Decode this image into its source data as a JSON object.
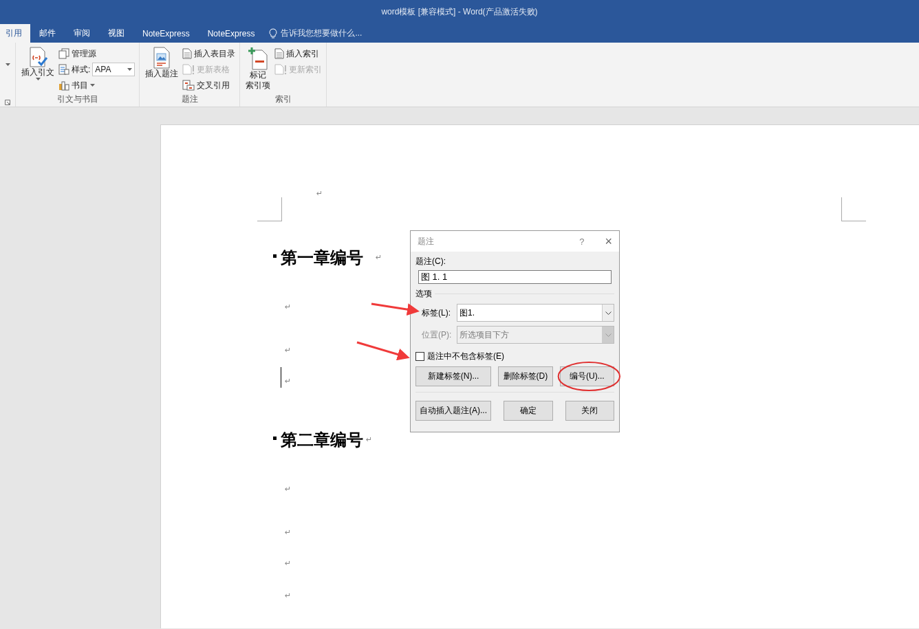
{
  "window": {
    "title": "word模板 [兼容模式] - Word(产品激活失败)"
  },
  "tabs": [
    {
      "label": "引用",
      "selected": true
    },
    {
      "label": "邮件",
      "selected": false
    },
    {
      "label": "审阅",
      "selected": false
    },
    {
      "label": "视图",
      "selected": false
    },
    {
      "label": "NoteExpress",
      "selected": false
    },
    {
      "label": "NoteExpress",
      "selected": false
    }
  ],
  "tell_me": {
    "placeholder": "告诉我您想要做什么..."
  },
  "ribbon": {
    "groups": [
      {
        "label": "引文与书目",
        "large": {
          "lines": [
            "插入引文"
          ],
          "dropdown": true
        },
        "small": [
          {
            "kind": "button",
            "label": "管理源",
            "disabled": false,
            "dropdown": false
          },
          {
            "kind": "combo",
            "label": "样式:",
            "value": "APA"
          },
          {
            "kind": "button",
            "label": "书目",
            "disabled": false,
            "dropdown": true
          }
        ]
      },
      {
        "label": "题注",
        "large": {
          "lines": [
            "插入题注"
          ],
          "dropdown": false
        },
        "small": [
          {
            "kind": "button",
            "label": "插入表目录",
            "disabled": false,
            "dropdown": false
          },
          {
            "kind": "button",
            "label": "更新表格",
            "disabled": true,
            "dropdown": false
          },
          {
            "kind": "button",
            "label": "交叉引用",
            "disabled": false,
            "dropdown": false
          }
        ]
      },
      {
        "label": "索引",
        "large": {
          "lines": [
            "标记",
            "索引项"
          ],
          "dropdown": false
        },
        "small": [
          {
            "kind": "button",
            "label": "插入索引",
            "disabled": false,
            "dropdown": false
          },
          {
            "kind": "button",
            "label": "更新索引",
            "disabled": true,
            "dropdown": false
          }
        ]
      }
    ]
  },
  "document": {
    "paragraphs": [
      {
        "kind": "empty",
        "mark": "↵",
        "caret": false
      },
      {
        "kind": "heading",
        "text": "第一章编号",
        "mark": "↵"
      },
      {
        "kind": "empty",
        "mark": "↵",
        "caret": false
      },
      {
        "kind": "empty",
        "mark": "↵",
        "caret": false
      },
      {
        "kind": "empty",
        "mark": "↵",
        "caret": true
      },
      {
        "kind": "heading",
        "text": "第二章编号",
        "mark": "↵"
      },
      {
        "kind": "empty",
        "mark": "↵",
        "caret": false
      },
      {
        "kind": "empty",
        "mark": "↵",
        "caret": false
      },
      {
        "kind": "empty",
        "mark": "↵",
        "caret": false
      },
      {
        "kind": "empty",
        "mark": "↵",
        "caret": false
      }
    ]
  },
  "dialog": {
    "title": "题注",
    "help": "?",
    "close": "×",
    "caption_label": "题注(C):",
    "caption_value": "图 1. 1",
    "options_label": "选项",
    "fields": [
      {
        "label": "标签(L):",
        "value": "图1.",
        "disabled": false
      },
      {
        "label": "位置(P):",
        "value": "所选项目下方",
        "disabled": true
      }
    ],
    "checkbox": {
      "label": "题注中不包含标签(E)",
      "checked": false
    },
    "row_buttons": [
      {
        "label": "新建标签(N)...",
        "circled": false
      },
      {
        "label": "删除标签(D)",
        "circled": false
      },
      {
        "label": "编号(U)...",
        "circled": true
      }
    ],
    "bottom_buttons": [
      "自动插入题注(A)...",
      "确定",
      "关闭"
    ]
  }
}
